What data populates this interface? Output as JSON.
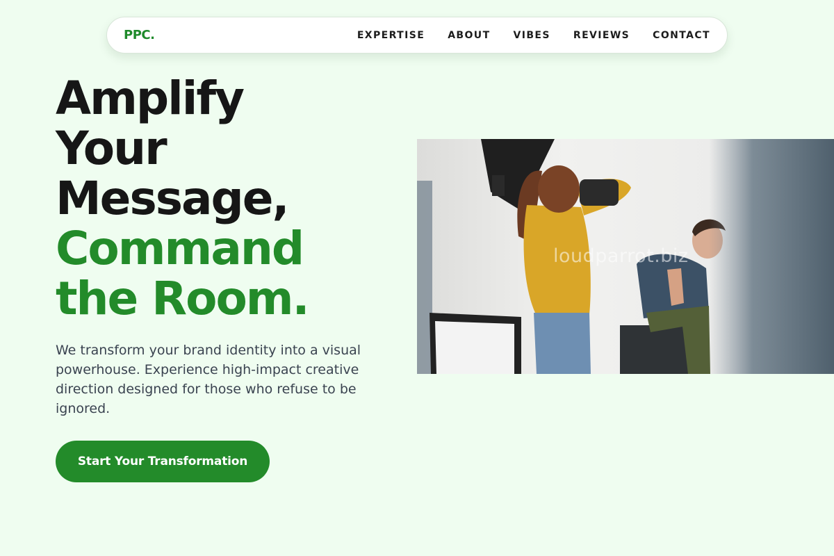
{
  "nav": {
    "logo": "PPC.",
    "links": [
      "EXPERTISE",
      "ABOUT",
      "VIBES",
      "REVIEWS",
      "CONTACT"
    ]
  },
  "hero": {
    "headline_dark": [
      "Amplify",
      "Your",
      "Message,"
    ],
    "headline_green": [
      "Command",
      "the Room."
    ],
    "subtext": "We transform your brand identity into a visual powerhouse. Experience high-impact creative direction designed for those who refuse to be ignored.",
    "cta_label": "Start Your Transformation"
  },
  "photo": {
    "watermark": "loudparrot.biz",
    "subject": "photographer in yellow sweater shooting a seated male model in a studio"
  },
  "colors": {
    "background": "#effdf0",
    "accent_green": "#238b2a",
    "headline_dark": "#161616",
    "body_text": "#3a4350"
  }
}
